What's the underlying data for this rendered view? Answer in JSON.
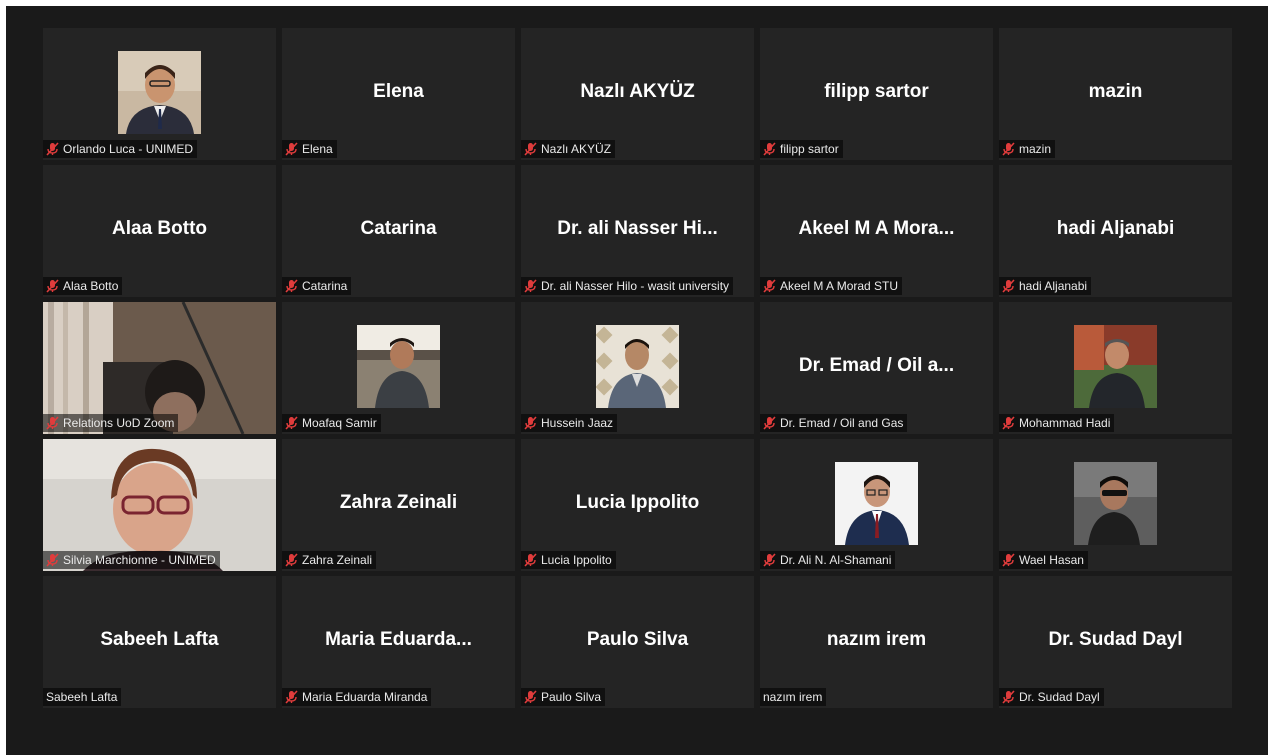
{
  "accent": {
    "muted_icon": "#e03c3c",
    "tile_bg": "#242424",
    "window_bg": "#1a1a1a"
  },
  "participants": [
    {
      "name": "",
      "label": "Orlando Luca - UNIMED",
      "muted": true,
      "video": "avatar-photo"
    },
    {
      "name": "Elena",
      "label": "Elena",
      "muted": true
    },
    {
      "name": "Nazlı AKYÜZ",
      "label": "Nazlı AKYÜZ",
      "muted": true
    },
    {
      "name": "filipp sartor",
      "label": "filipp sartor",
      "muted": true
    },
    {
      "name": "mazin",
      "label": "mazin",
      "muted": true
    },
    {
      "name": "Alaa Botto",
      "label": "Alaa Botto",
      "muted": true
    },
    {
      "name": "Catarina",
      "label": "Catarina",
      "muted": true
    },
    {
      "name": "Dr. ali Nasser Hi...",
      "label": "Dr. ali Nasser Hilo - wasit university",
      "muted": true
    },
    {
      "name": "Akeel M A Mora...",
      "label": "Akeel M A Morad STU",
      "muted": true
    },
    {
      "name": "hadi Aljanabi",
      "label": "hadi Aljanabi",
      "muted": true
    },
    {
      "name": "",
      "label": "Relations UoD Zoom",
      "muted": true,
      "video": "live-video"
    },
    {
      "name": "",
      "label": "Moafaq Samir",
      "muted": true,
      "video": "avatar-photo"
    },
    {
      "name": "",
      "label": "Hussein Jaaz",
      "muted": true,
      "video": "avatar-photo"
    },
    {
      "name": "Dr. Emad / Oil a...",
      "label": "Dr. Emad / Oil and Gas",
      "muted": true
    },
    {
      "name": "",
      "label": "Mohammad Hadi",
      "muted": true,
      "video": "avatar-photo"
    },
    {
      "name": "",
      "label": "Silvia Marchionne - UNIMED",
      "muted": true,
      "video": "live-video"
    },
    {
      "name": "Zahra Zeinali",
      "label": "Zahra Zeinali",
      "muted": true
    },
    {
      "name": "Lucia Ippolito",
      "label": "Lucia Ippolito",
      "muted": true
    },
    {
      "name": "",
      "label": "Dr. Ali N. Al-Shamani",
      "muted": true,
      "video": "avatar-photo"
    },
    {
      "name": "",
      "label": "Wael Hasan",
      "muted": true,
      "video": "avatar-photo"
    },
    {
      "name": "Sabeeh Lafta",
      "label": "Sabeeh Lafta",
      "muted": false
    },
    {
      "name": "Maria  Eduarda...",
      "label": "Maria Eduarda Miranda",
      "muted": true
    },
    {
      "name": "Paulo Silva",
      "label": "Paulo Silva",
      "muted": true
    },
    {
      "name": "nazım irem",
      "label": "nazım irem",
      "muted": false
    },
    {
      "name": "Dr. Sudad Dayl",
      "label": "Dr. Sudad Dayl",
      "muted": true
    }
  ]
}
